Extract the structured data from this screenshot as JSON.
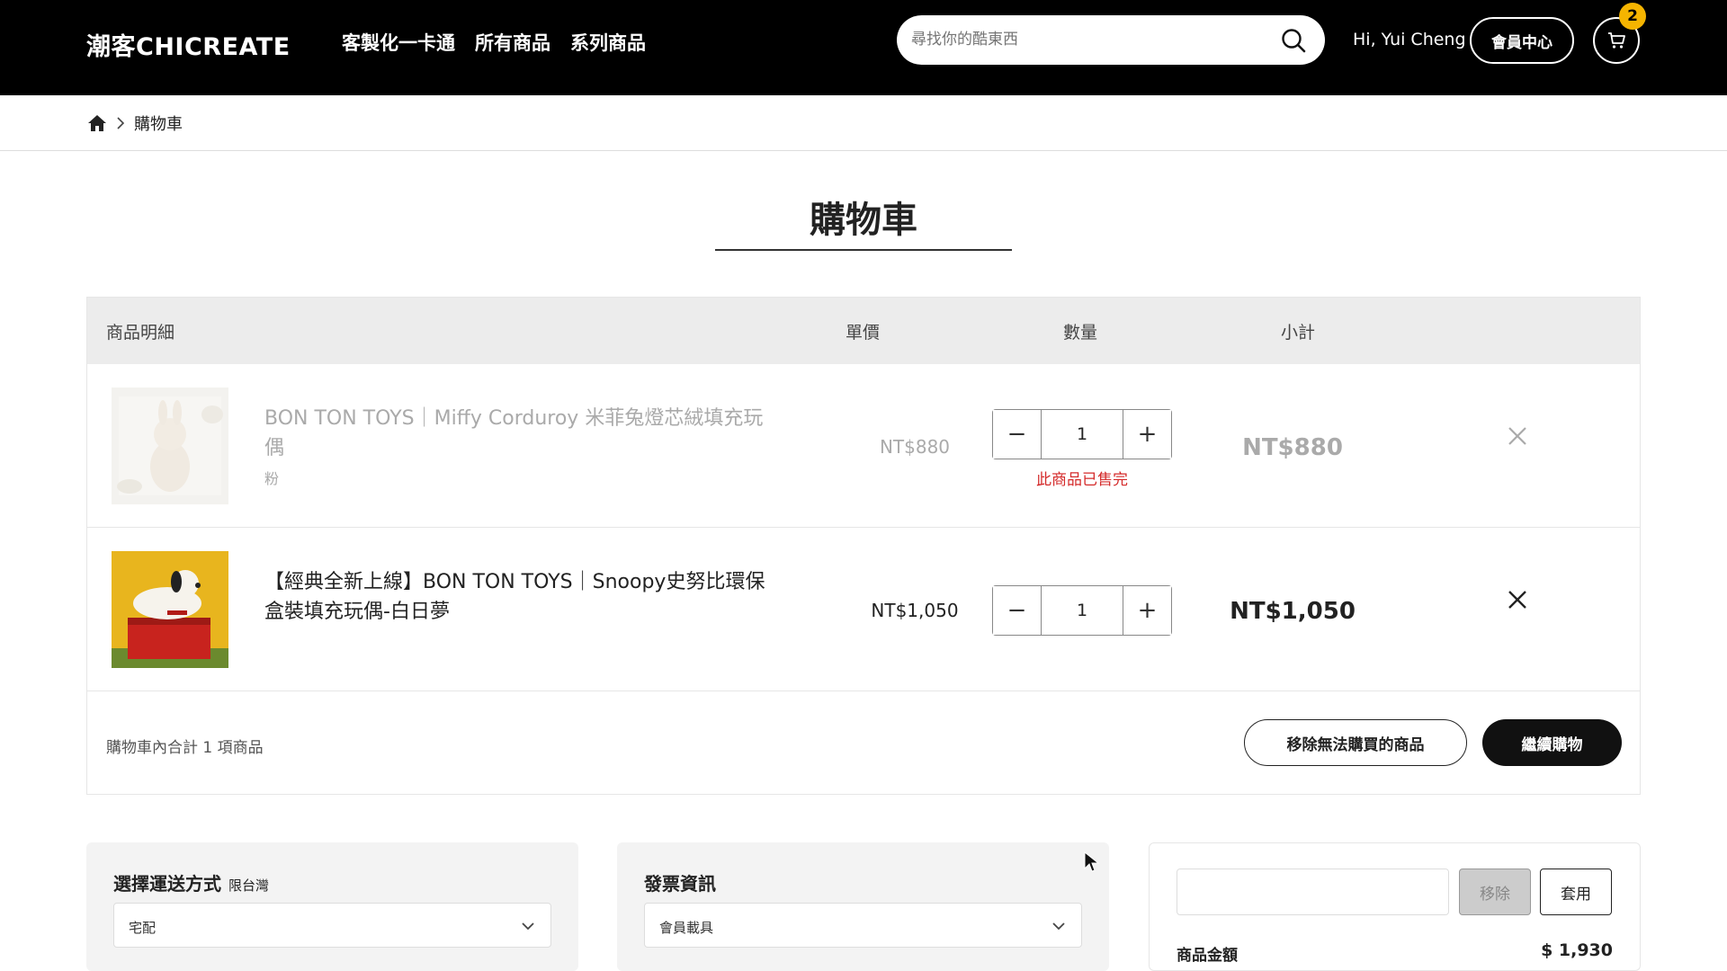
{
  "header": {
    "logo": "潮客CHICREATE",
    "nav": [
      "客製化一卡通",
      "所有商品",
      "系列商品"
    ],
    "search_placeholder": "尋找你的酷東西",
    "greeting": "Hi, Yui Cheng",
    "member_center": "會員中心",
    "cart_count": "2"
  },
  "breadcrumb": {
    "current": "購物車"
  },
  "page_title": "購物車",
  "table": {
    "headers": {
      "detail": "商品明細",
      "price": "單價",
      "qty": "數量",
      "subtotal": "小計"
    },
    "items": [
      {
        "name": "BON TON TOYS｜Miffy Corduroy 米菲兔燈芯絨填充玩偶",
        "variant": "粉",
        "price": "NT$880",
        "qty": "1",
        "subtotal": "NT$880",
        "status": "此商品已售完",
        "available": false
      },
      {
        "name": "【經典全新上線】BON TON TOYS｜Snoopy史努比環保盒裝填充玩偶-白日夢",
        "variant": "",
        "price": "NT$1,050",
        "qty": "1",
        "subtotal": "NT$1,050",
        "status": "",
        "available": true
      }
    ],
    "footer_text": "購物車內合計 1 項商品",
    "remove_unavailable": "移除無法購買的商品",
    "continue_shopping": "繼續購物"
  },
  "shipping": {
    "title": "選擇運送方式",
    "note": "限台灣",
    "selected": "宅配"
  },
  "invoice": {
    "title": "發票資訊",
    "selected": "會員載具"
  },
  "summary": {
    "remove_label": "移除",
    "apply_label": "套用",
    "goods_amount_label": "商品金額",
    "goods_amount_value": "$ 1,930"
  },
  "colors": {
    "header_bg": "#000000",
    "badge": "#f5b400",
    "soldout": "#d42a2a"
  }
}
